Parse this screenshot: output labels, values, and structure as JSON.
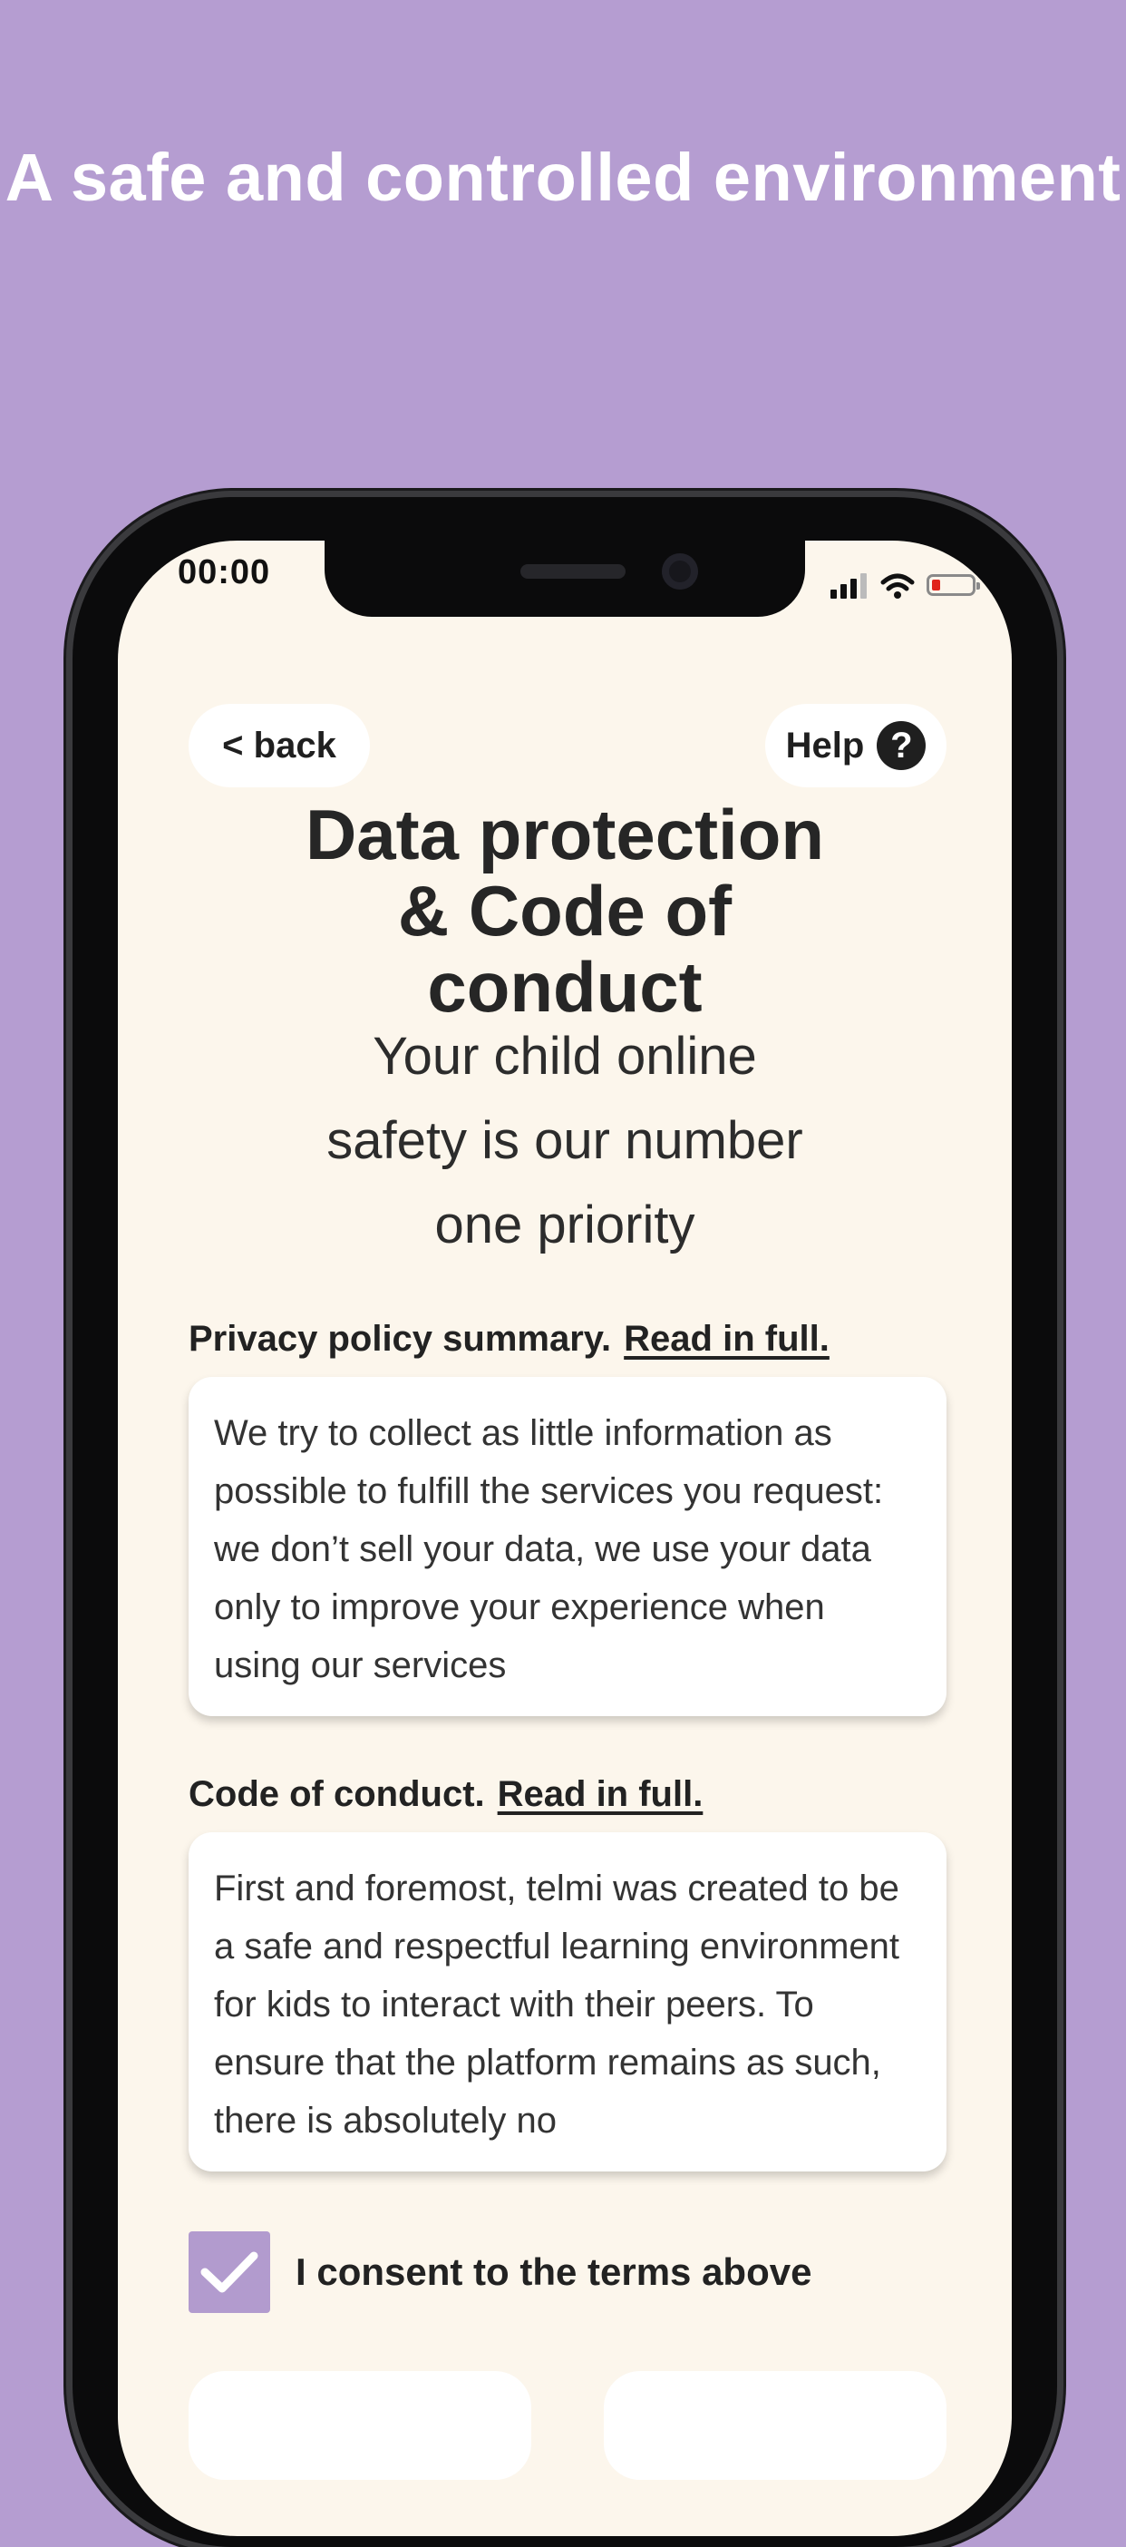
{
  "promo": {
    "title": "A safe and controlled environment"
  },
  "status_bar": {
    "time": "00:00"
  },
  "nav": {
    "back_label": "< back",
    "help_label": "Help",
    "help_icon_glyph": "?"
  },
  "header": {
    "title": "Data protection & Code of conduct",
    "subtitle": "Your child online safety is our number one priority"
  },
  "privacy": {
    "label": "Privacy policy summary.",
    "link": "Read in full.",
    "text": "We try to collect as little information as possible to fulfill the services you request: we don’t sell your data, we use your data only to improve your experience when using our services"
  },
  "conduct": {
    "label": "Code of conduct.",
    "link": "Read in full.",
    "text": "First and foremost, telmi was created to be a safe and respectful learning environment for kids to interact with their peers. To ensure that the platform remains as such, there is absolutely no"
  },
  "consent": {
    "label": "I consent to the terms above",
    "checked": true
  },
  "colors": {
    "background": "#b59dd1",
    "screen": "#fcf6ec",
    "accent": "#b29bce",
    "battery_low": "#e0241b"
  },
  "icons": [
    "signal-icon",
    "wifi-icon",
    "battery-icon",
    "help-icon",
    "checkmark-icon"
  ]
}
